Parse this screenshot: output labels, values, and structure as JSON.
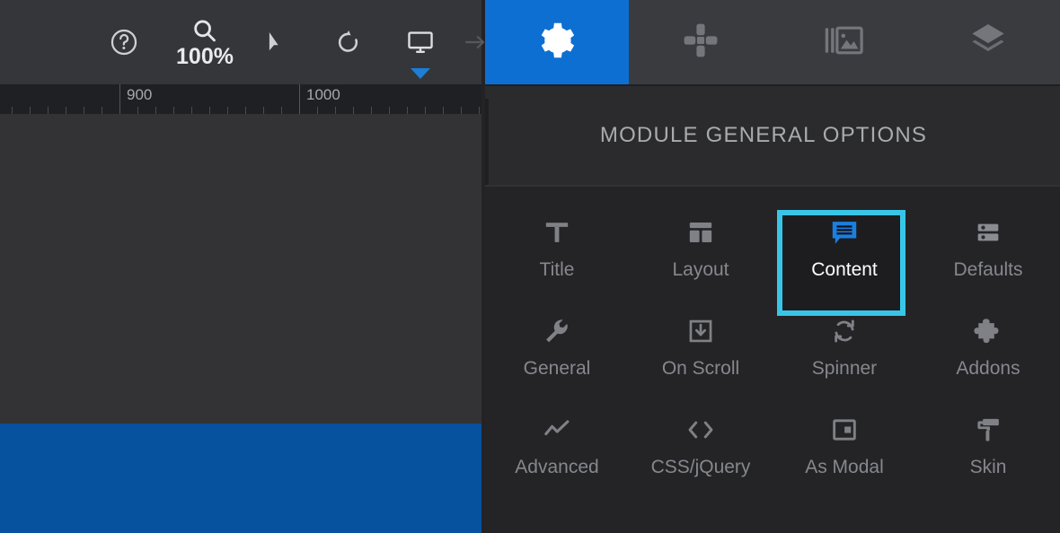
{
  "editor": {
    "toolbar": {
      "items": [
        {
          "name": "help-icon",
          "label": ""
        },
        {
          "name": "zoom-icon",
          "label": "100%"
        },
        {
          "name": "cursor-icon",
          "label": ""
        },
        {
          "name": "undo-icon",
          "label": ""
        },
        {
          "name": "preview-device-icon",
          "label": ""
        },
        {
          "name": "arrow-right-icon",
          "label": ""
        }
      ],
      "zoom_level": "100%"
    },
    "ruler": {
      "labels": [
        "900",
        "1000"
      ],
      "label_positions": [
        140,
        340
      ]
    },
    "canvas": {
      "background_color": "#333336",
      "band_color": "#07529e"
    }
  },
  "panel": {
    "tabs": [
      {
        "id": "general",
        "icon": "gear-icon",
        "active": true
      },
      {
        "id": "navigation",
        "icon": "move-cross-icon",
        "active": false
      },
      {
        "id": "slides",
        "icon": "slides-image-icon",
        "active": false
      },
      {
        "id": "layers",
        "icon": "layers-icon",
        "active": false
      }
    ],
    "title": "MODULE GENERAL OPTIONS",
    "accent_color": "#0d6fd1",
    "highlight_color": "#38c6e8",
    "options": [
      {
        "label": "Title",
        "icon": "text-title-icon",
        "selected": false
      },
      {
        "label": "Layout",
        "icon": "layout-icon",
        "selected": false
      },
      {
        "label": "Content",
        "icon": "content-bubble-icon",
        "selected": true
      },
      {
        "label": "Defaults",
        "icon": "defaults-server-icon",
        "selected": false
      },
      {
        "label": "General",
        "icon": "wrench-icon",
        "selected": false
      },
      {
        "label": "On Scroll",
        "icon": "download-box-icon",
        "selected": false
      },
      {
        "label": "Spinner",
        "icon": "sync-spinner-icon",
        "selected": false
      },
      {
        "label": "Addons",
        "icon": "puzzle-icon",
        "selected": false
      },
      {
        "label": "Advanced",
        "icon": "line-chart-icon",
        "selected": false
      },
      {
        "label": "CSS/jQuery",
        "icon": "code-brackets-icon",
        "selected": false
      },
      {
        "label": "As Modal",
        "icon": "modal-window-icon",
        "selected": false
      },
      {
        "label": "Skin",
        "icon": "paint-roller-icon",
        "selected": false
      }
    ]
  },
  "annotation": {
    "pointer": {
      "icon": "arrow-right-icon",
      "color": "#2ec2e0"
    }
  }
}
